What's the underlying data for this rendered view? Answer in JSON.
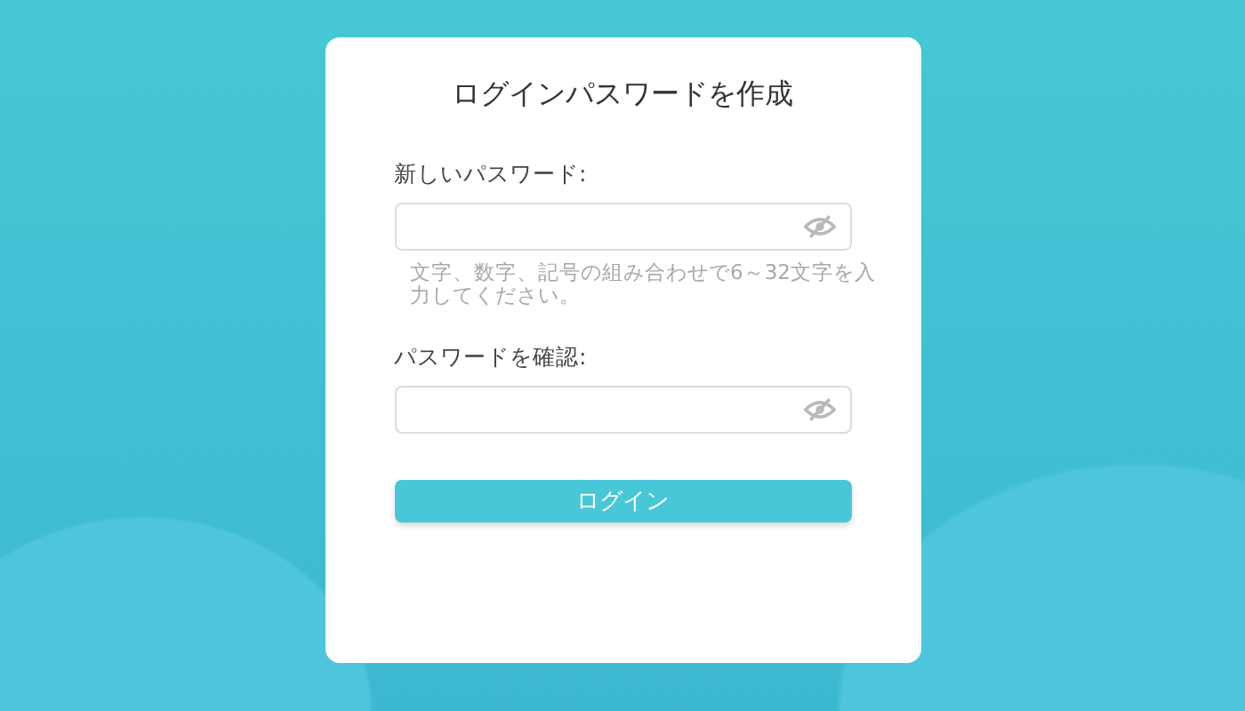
{
  "dialog": {
    "title": "ログインパスワードを作成",
    "fields": [
      {
        "label": "新しいパスワード:",
        "hint": "文字、数字、記号の組み合わせで6～32文字を入力してください。"
      },
      {
        "label": "パスワードを確認:"
      }
    ],
    "button": "ログイン"
  }
}
